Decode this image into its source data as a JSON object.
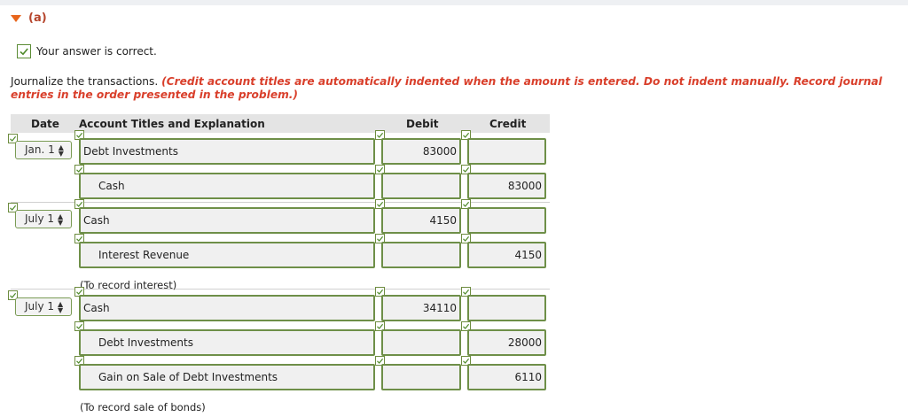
{
  "part": {
    "label": "(a)"
  },
  "status": {
    "text": "Your answer is correct."
  },
  "instructions": {
    "plain": "Journalize the transactions. ",
    "emphasis": "(Credit account titles are automatically indented when the amount is entered. Do not indent manually. Record journal entries in the order presented in the problem.)"
  },
  "table": {
    "headers": {
      "date": "Date",
      "account": "Account Titles and Explanation",
      "debit": "Debit",
      "credit": "Credit"
    },
    "entries": [
      {
        "date": "Jan. 1",
        "lines": [
          {
            "account": "Debt Investments",
            "debit": "83000",
            "credit": ""
          },
          {
            "account": "Cash",
            "debit": "",
            "credit": "83000"
          }
        ],
        "note": ""
      },
      {
        "date": "July 1",
        "lines": [
          {
            "account": "Cash",
            "debit": "4150",
            "credit": ""
          },
          {
            "account": "Interest Revenue",
            "debit": "",
            "credit": "4150"
          }
        ],
        "note": "(To record interest)"
      },
      {
        "date": "July 1",
        "lines": [
          {
            "account": "Cash",
            "debit": "34110",
            "credit": ""
          },
          {
            "account": "Debt Investments",
            "debit": "",
            "credit": "28000"
          },
          {
            "account": "Gain on Sale of Debt Investments",
            "debit": "",
            "credit": "6110"
          }
        ],
        "note": "(To record sale of bonds)"
      }
    ]
  },
  "icons": {
    "collapse": "triangle-down-icon",
    "check": "checkmark-icon",
    "select": "select-arrows-icon"
  },
  "colors": {
    "accent": "#e8651b",
    "emphasis": "#d93f2b",
    "field_border": "#6e8f48",
    "check": "#5b8c35"
  }
}
